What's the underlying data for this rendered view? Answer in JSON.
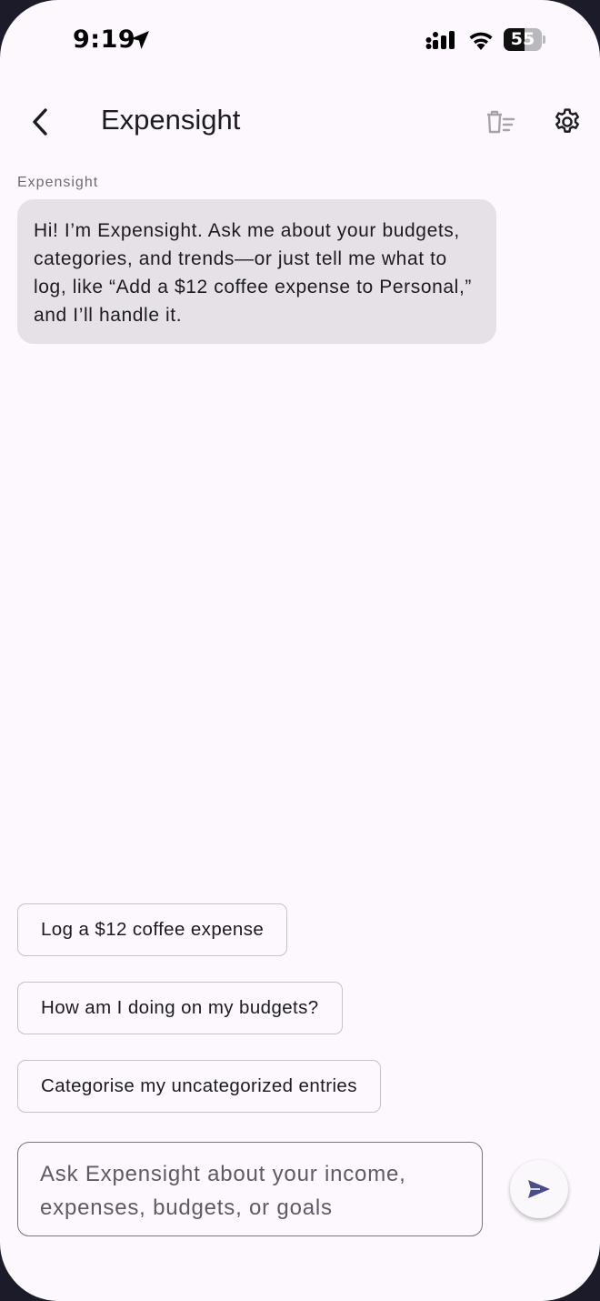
{
  "status_bar": {
    "time": "9:19",
    "battery_level": "55",
    "battery_fraction": 0.55
  },
  "app_bar": {
    "title": "Expensight",
    "icons": {
      "back": "chevron-left-icon",
      "clear": "clear-history-icon",
      "settings": "gear-icon"
    }
  },
  "chat": {
    "messages": [
      {
        "sender": "Expensight",
        "text": "Hi! I’m Expensight. Ask me about your budgets, categories, and trends—or just tell me what to log, like “Add a $12 coffee expense to Personal,” and I’ll handle it."
      }
    ]
  },
  "suggestions": [
    "Log a $12 coffee expense",
    "How am I doing on my budgets?",
    "Categorise my uncategorized entries"
  ],
  "composer": {
    "placeholder": "Ask Expensight about your income, expenses, budgets, or goals",
    "value": "",
    "send_icon": "send-icon"
  },
  "colors": {
    "background": "#fcf8fe",
    "bubble": "#e6e1e7",
    "accent": "#4a4d8c"
  }
}
